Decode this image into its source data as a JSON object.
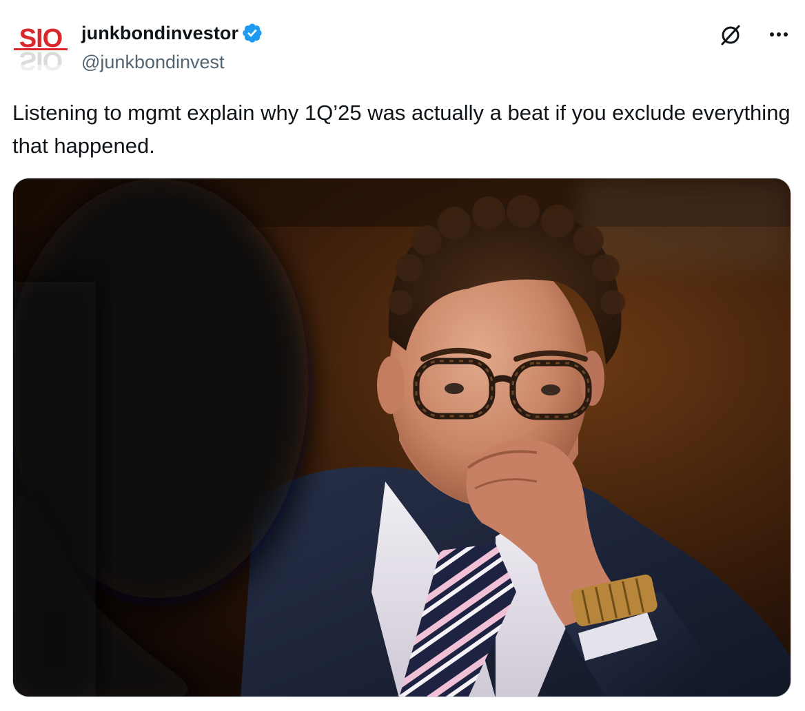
{
  "author": {
    "display_name": "junkbondinvestor",
    "handle": "@junkbondinvest",
    "verified": true,
    "avatar_logo_text": "SIO",
    "avatar_icon": "logo-avatar"
  },
  "actions": {
    "grok_icon": "grok-slash-circle-icon",
    "more_icon": "more-dots-icon"
  },
  "tweet": {
    "text": "Listening to mgmt explain why 1Q’25 was actually a beat if you exclude everything that happened."
  },
  "media": {
    "kind": "photo",
    "alt": ""
  },
  "colors": {
    "verified_blue": "#1d9bf0",
    "text_primary": "#0f1419",
    "text_secondary": "#536471",
    "logo_red": "#d8282c"
  }
}
